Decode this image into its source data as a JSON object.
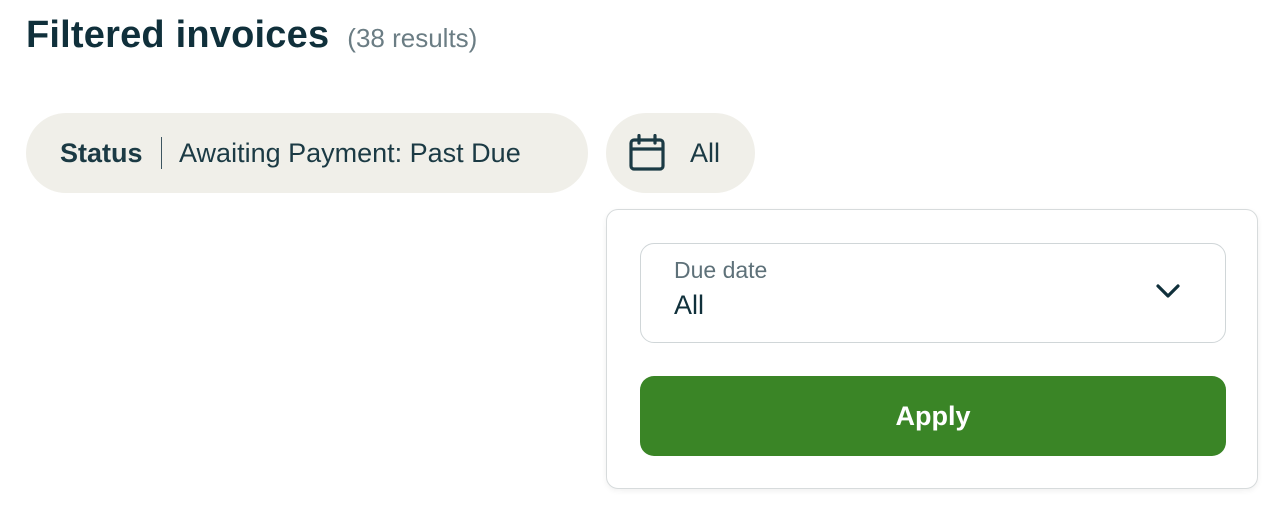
{
  "header": {
    "title": "Filtered invoices",
    "result_count": "(38 results)"
  },
  "filters": {
    "status": {
      "label": "Status",
      "value": "Awaiting Payment: Past Due"
    },
    "date": {
      "icon": "calendar-icon",
      "value": "All"
    }
  },
  "date_popover": {
    "select": {
      "label": "Due date",
      "value": "All",
      "icon": "chevron-down-icon"
    },
    "apply_label": "Apply"
  },
  "colors": {
    "chip_background": "#f0efe9",
    "primary_button": "#3a8526",
    "text_dark": "#10303b"
  }
}
